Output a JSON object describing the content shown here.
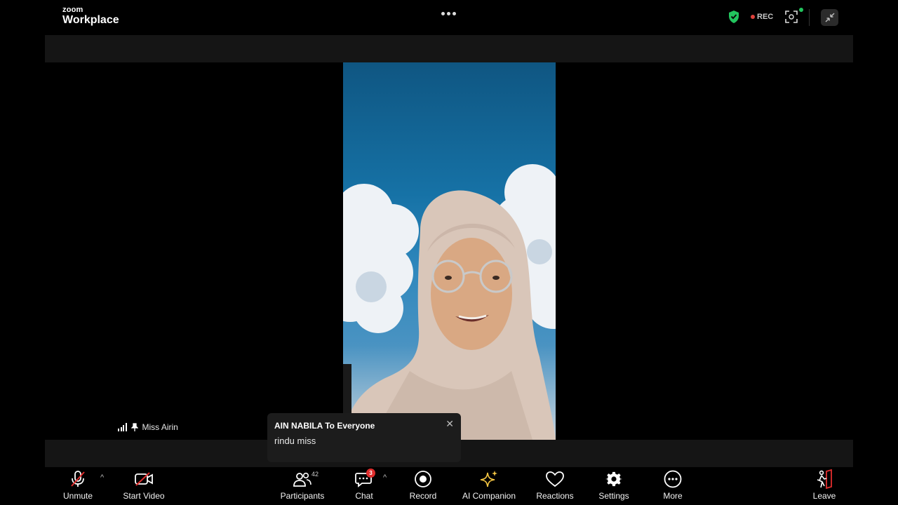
{
  "brand": {
    "small": "zoom",
    "big": "Workplace"
  },
  "header": {
    "rec_label": "REC"
  },
  "participant": {
    "name": "Miss Airin"
  },
  "chat_popup": {
    "sender": "AIN NABILA To Everyone",
    "message": "rindu miss",
    "close": "✕"
  },
  "toolbar": {
    "unmute": "Unmute",
    "start_video": "Start Video",
    "participants": "Participants",
    "participants_count": "42",
    "chat": "Chat",
    "chat_badge": "3",
    "record": "Record",
    "ai_companion": "AI Companion",
    "reactions": "Reactions",
    "settings": "Settings",
    "more": "More",
    "leave": "Leave"
  },
  "colors": {
    "accent_red": "#e02d2d",
    "secure_green": "#22c55e",
    "ai_gold": "#f4c542"
  }
}
